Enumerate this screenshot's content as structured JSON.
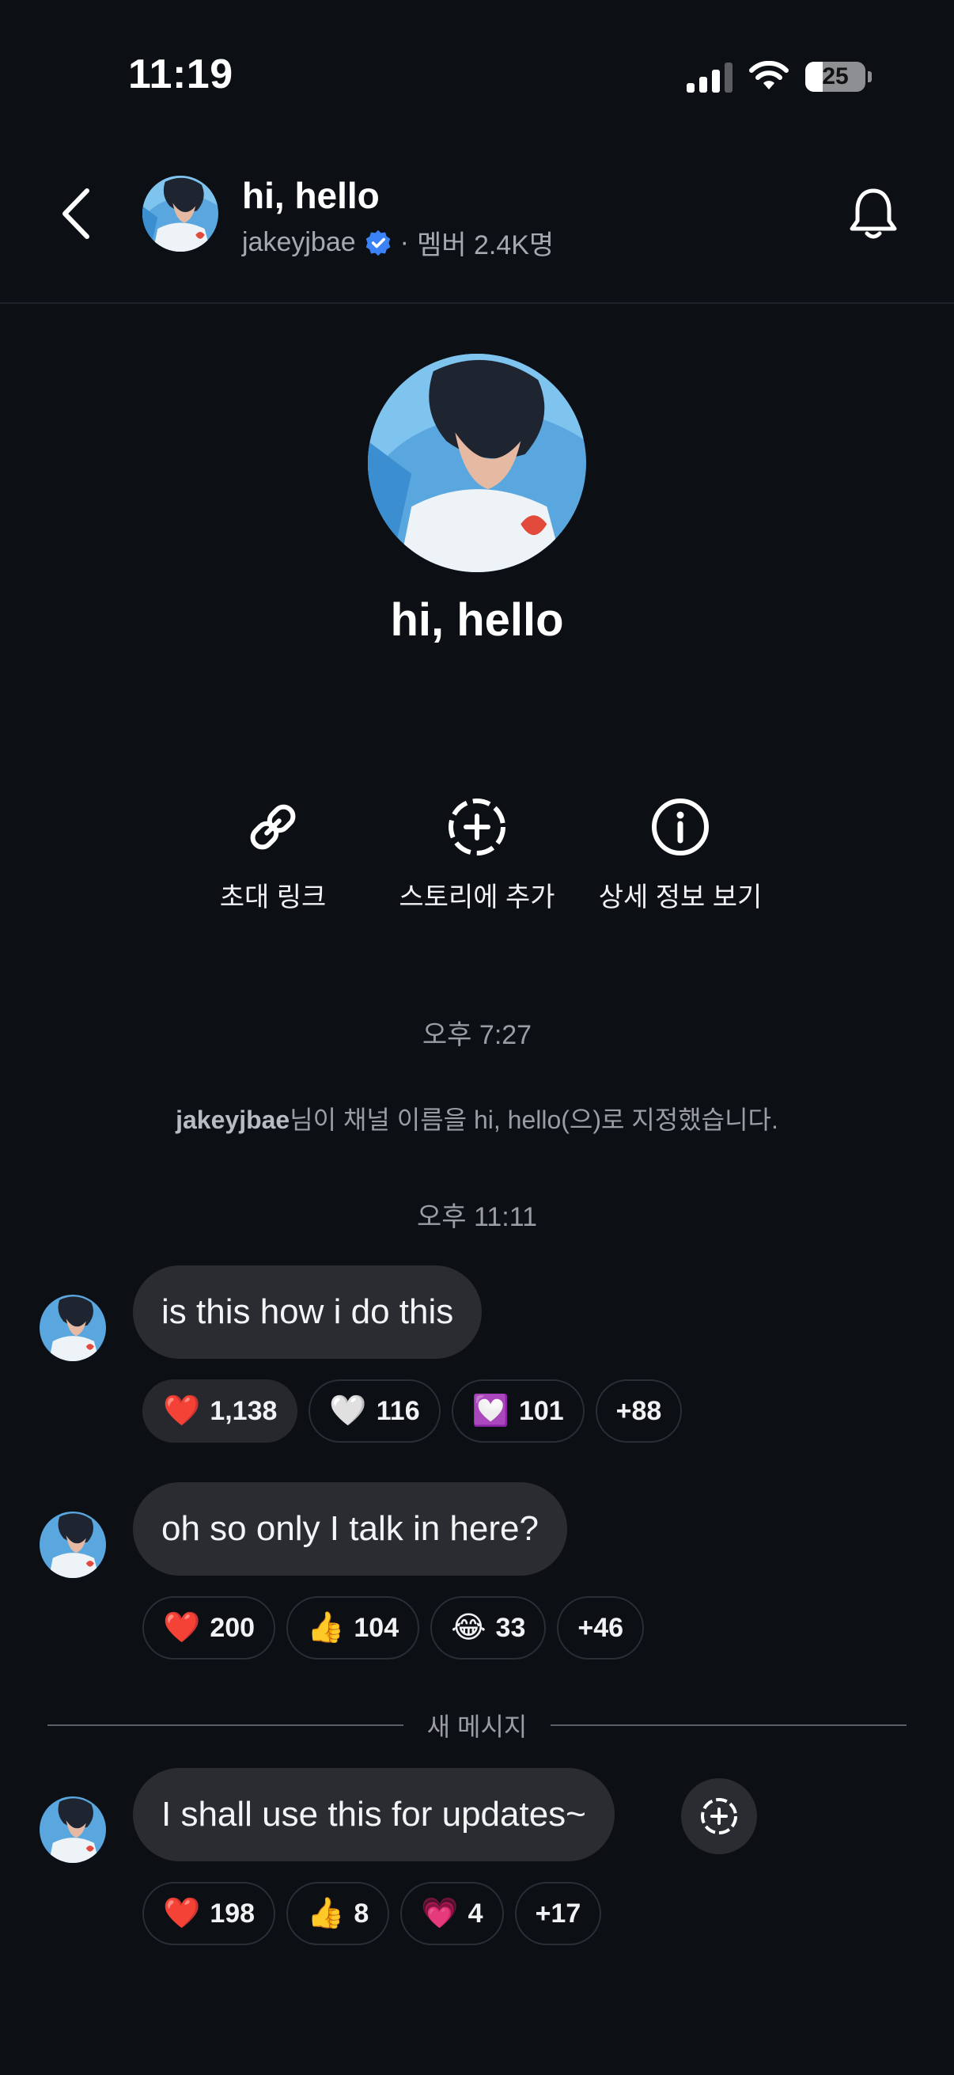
{
  "status_bar": {
    "time": "11:19",
    "battery": "25"
  },
  "header": {
    "title": "hi, hello",
    "username": "jakeyjbae",
    "separator": "·",
    "members": "멤버 2.4K명"
  },
  "profile": {
    "name": "hi, hello"
  },
  "actions": [
    {
      "label": "초대 링크",
      "icon": "link-icon"
    },
    {
      "label": "스토리에 추가",
      "icon": "add-circle-dashed-icon"
    },
    {
      "label": "상세 정보 보기",
      "icon": "info-icon"
    }
  ],
  "timeline": {
    "time1": "오후 7:27",
    "system_user": "jakeyjbae",
    "system_text": "님이 채널 이름을 hi, hello(으)로 지정했습니다.",
    "time2": "오후 11:11",
    "new_messages_label": "새 메시지"
  },
  "messages": [
    {
      "text": "is this how i do this",
      "reactions": [
        {
          "emoji": "❤️",
          "count": "1,138"
        },
        {
          "emoji": "🤍",
          "count": "116"
        },
        {
          "emoji": "💟",
          "count": "101"
        },
        {
          "emoji": "",
          "count": "+88"
        }
      ]
    },
    {
      "text": "oh so only I talk in here?",
      "reactions": [
        {
          "emoji": "❤️",
          "count": "200"
        },
        {
          "emoji": "👍",
          "count": "104"
        },
        {
          "emoji": "😂",
          "count": "33"
        },
        {
          "emoji": "",
          "count": "+46"
        }
      ]
    },
    {
      "text": "I shall use this for updates~",
      "reactions": [
        {
          "emoji": "❤️",
          "count": "198"
        },
        {
          "emoji": "👍",
          "count": "8"
        },
        {
          "emoji": "💗",
          "count": "4"
        },
        {
          "emoji": "",
          "count": "+17"
        }
      ]
    }
  ],
  "colors": {
    "background": "#0c0f14",
    "bubble": "#2a2c31",
    "verified": "#3b82f6",
    "muted_text": "#9a9da4"
  }
}
